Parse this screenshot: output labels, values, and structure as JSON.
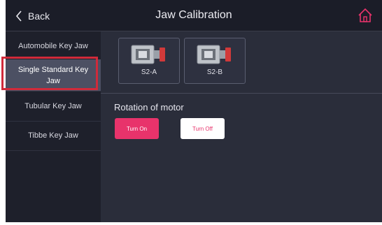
{
  "header": {
    "back_label": "Back",
    "title": "Jaw Calibration",
    "home_icon": "home-icon"
  },
  "sidebar": {
    "items": [
      {
        "label": "Automobile Key Jaw",
        "active": false
      },
      {
        "label": "Single Standard Key Jaw",
        "active": true
      },
      {
        "label": "Tubular Key Jaw",
        "active": false
      },
      {
        "label": "Tibbe Key Jaw",
        "active": false
      }
    ]
  },
  "jaws": [
    {
      "label": "S2-A",
      "icon": "jaw-clamp-icon"
    },
    {
      "label": "S2-B",
      "icon": "jaw-clamp-icon"
    }
  ],
  "motor": {
    "title": "Rotation of motor",
    "on_label": "Turn On",
    "off_label": "Turn Off"
  },
  "colors": {
    "accent": "#e8336b",
    "header_bg": "#1b1d28",
    "sidebar_bg": "#1e202b",
    "sidebar_active": "#4c5063",
    "main_bg": "#2a2d3a",
    "highlight": "#d02a3a"
  }
}
